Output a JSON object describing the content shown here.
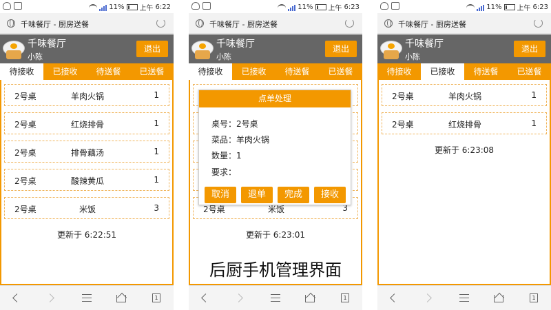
{
  "status_bar": {
    "battery": "11%",
    "carrier_label": "上午",
    "times": [
      "6:22",
      "6:23",
      "6:23"
    ]
  },
  "browser": {
    "page_title": "千味餐厅 - 厨房送餐"
  },
  "header": {
    "restaurant": "千味餐厅",
    "user": "小陈",
    "logout_label": "退出"
  },
  "tabs": [
    "待接收",
    "已接收",
    "待送餐",
    "已送餐"
  ],
  "screens": [
    {
      "active_tab": 0,
      "orders": [
        {
          "table": "2号桌",
          "dish": "羊肉火锅",
          "qty": "1"
        },
        {
          "table": "2号桌",
          "dish": "红烧排骨",
          "qty": "1"
        },
        {
          "table": "2号桌",
          "dish": "排骨藕汤",
          "qty": "1"
        },
        {
          "table": "2号桌",
          "dish": "酸辣黄瓜",
          "qty": "1"
        },
        {
          "table": "2号桌",
          "dish": "米饭",
          "qty": "3"
        }
      ],
      "updated": "更新于 6:22:51"
    },
    {
      "active_tab": 0,
      "orders": [
        {
          "table": "",
          "dish": "",
          "qty": ""
        },
        {
          "table": "",
          "dish": "",
          "qty": ""
        },
        {
          "table": "",
          "dish": "",
          "qty": ""
        },
        {
          "table": "",
          "dish": "",
          "qty": ""
        },
        {
          "table": "2号桌",
          "dish": "米饭",
          "qty": "3"
        }
      ],
      "updated": "更新于 6:23:01",
      "modal": {
        "title": "点单处理",
        "table_line": "桌号：2号桌",
        "dish_line": "菜品：羊肉火锅",
        "qty_line": "数量：1",
        "note_line": "要求：",
        "buttons": [
          "取消",
          "退单",
          "完成",
          "接收"
        ]
      },
      "caption": "后厨手机管理界面"
    },
    {
      "active_tab": 1,
      "orders": [
        {
          "table": "2号桌",
          "dish": "羊肉火锅",
          "qty": "1"
        },
        {
          "table": "2号桌",
          "dish": "红烧排骨",
          "qty": "1"
        }
      ],
      "updated": "更新于 6:23:08"
    }
  ],
  "colors": {
    "accent": "#f39800",
    "header_bg": "#666666"
  }
}
